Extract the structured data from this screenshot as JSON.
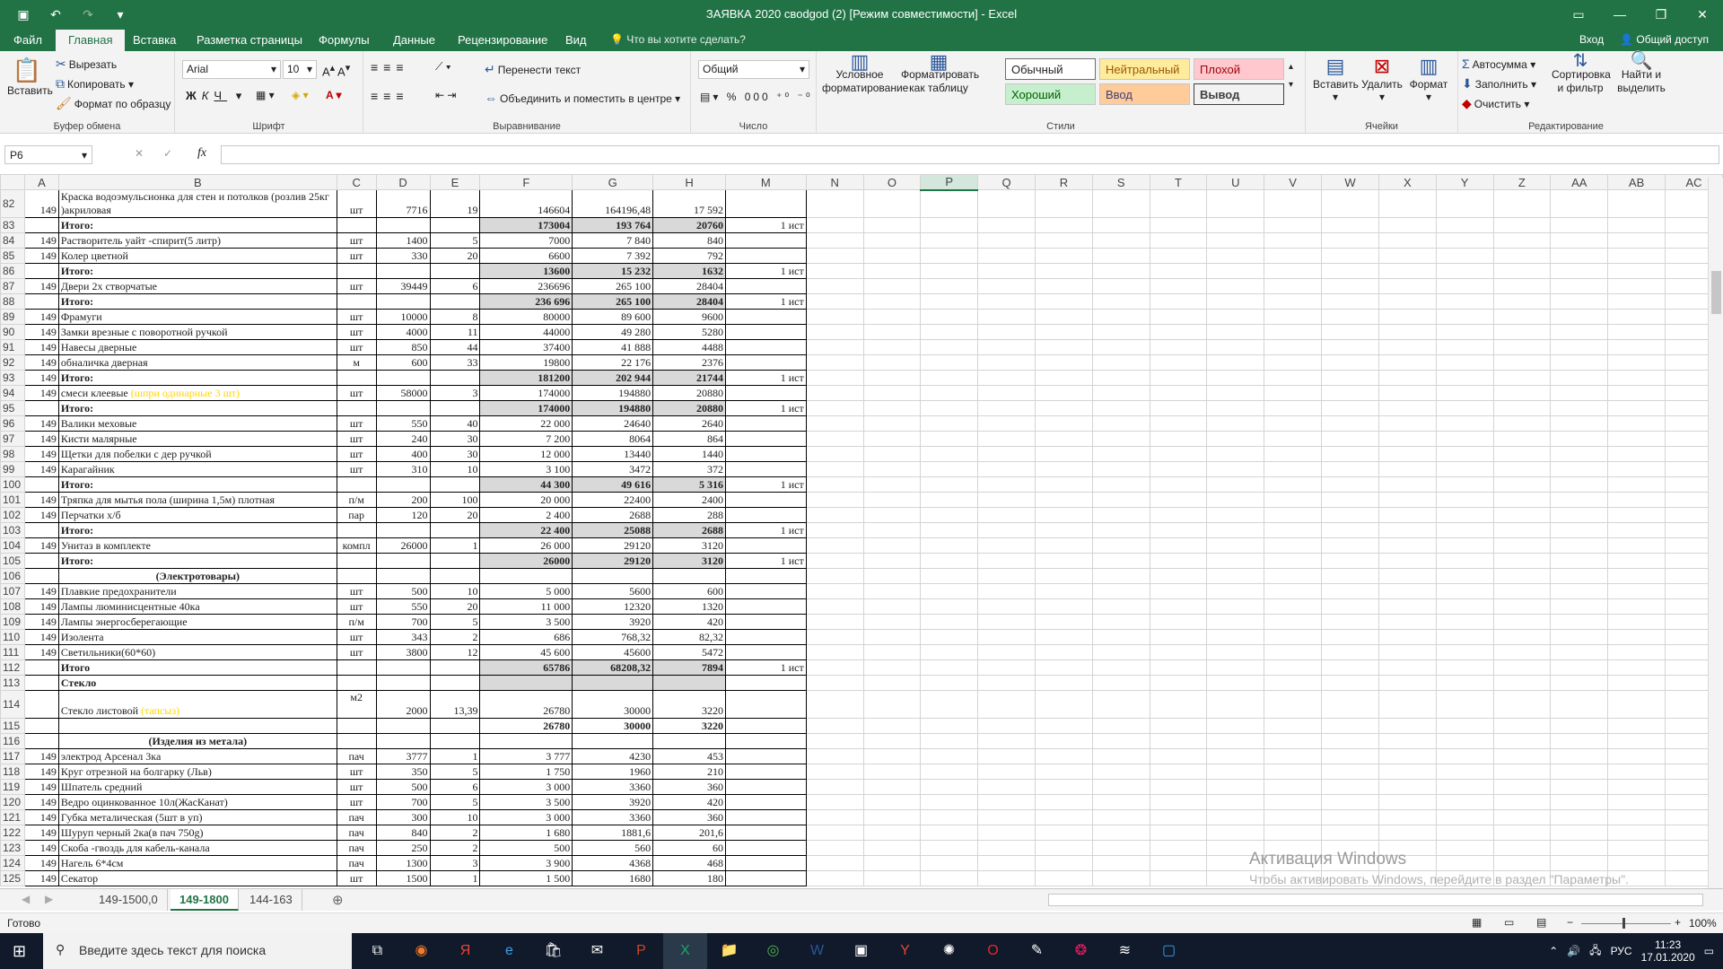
{
  "window": {
    "title": "ЗАЯВКА 2020 свodgod (2)  [Режим совместимости] - Excel",
    "sign_in": "Вход",
    "share": "Общий доступ"
  },
  "menu_tabs": [
    "Файл",
    "Главная",
    "Вставка",
    "Разметка страницы",
    "Формулы",
    "Данные",
    "Рецензирование",
    "Вид"
  ],
  "tell_me": "Что вы хотите сделать?",
  "ribbon": {
    "clipboard": {
      "paste": "Вставить",
      "cut": "Вырезать",
      "copy": "Копировать",
      "format_painter": "Формат по образцу",
      "label": "Буфер обмена"
    },
    "font": {
      "name": "Arial",
      "size": "10",
      "label": "Шрифт"
    },
    "alignment": {
      "wrap": "Перенести текст",
      "merge": "Объединить и поместить в центре",
      "label": "Выравнивание"
    },
    "number": {
      "format": "Общий",
      "label": "Число"
    },
    "styles": {
      "conditional": "Условное форматирование",
      "as_table": "Форматировать как таблицу",
      "normal": "Обычный",
      "neutral": "Нейтральный",
      "bad": "Плохой",
      "good": "Хороший",
      "input": "Ввод",
      "output": "Вывод",
      "label": "Стили"
    },
    "cells": {
      "insert": "Вставить",
      "delete": "Удалить",
      "format": "Формат",
      "label": "Ячейки"
    },
    "editing": {
      "autosum": "Автосумма",
      "fill": "Заполнить",
      "clear": "Очистить",
      "sort": "Сортировка и фильтр",
      "find": "Найти и выделить",
      "label": "Редактирование"
    }
  },
  "namebox": "P6",
  "columns": [
    "A",
    "B",
    "C",
    "D",
    "E",
    "F",
    "G",
    "H",
    "M",
    "N",
    "O",
    "P",
    "Q",
    "R",
    "S",
    "T",
    "U",
    "V",
    "W",
    "X",
    "Y",
    "Z",
    "AA",
    "AB",
    "AC"
  ],
  "rows": [
    {
      "n": "82",
      "a": "149",
      "b": "Краска водоэмульсионка для стен и потолков (розлив 25кг )акриловая",
      "c": "шт",
      "d": "7716",
      "e": "19",
      "f": "146604",
      "g": "164196,48",
      "h": "17 592",
      "m": "",
      "tall": true
    },
    {
      "n": "83",
      "a": "",
      "b": "Итого:",
      "c": "",
      "d": "",
      "e": "",
      "f": "173004",
      "g": "193 764",
      "h": "20760",
      "m": "1 ист",
      "tot": true
    },
    {
      "n": "84",
      "a": "149",
      "b": "Растворитель уайт -спирит(5 литр)",
      "c": "шт",
      "d": "1400",
      "e": "5",
      "f": "7000",
      "g": "7 840",
      "h": "840",
      "m": ""
    },
    {
      "n": "85",
      "a": "149",
      "b": "Колер цветной",
      "c": "шт",
      "d": "330",
      "e": "20",
      "f": "6600",
      "g": "7 392",
      "h": "792",
      "m": ""
    },
    {
      "n": "86",
      "a": "",
      "b": "Итого:",
      "c": "",
      "d": "",
      "e": "",
      "f": "13600",
      "g": "15 232",
      "h": "1632",
      "m": "1 ист",
      "tot": true
    },
    {
      "n": "87",
      "a": "149",
      "b": "Двери 2х створчатые",
      "c": "шт",
      "d": "39449",
      "e": "6",
      "f": "236696",
      "g": "265 100",
      "h": "28404",
      "m": ""
    },
    {
      "n": "88",
      "a": "",
      "b": "Итого:",
      "c": "",
      "d": "",
      "e": "",
      "f": "236 696",
      "g": "265 100",
      "h": "28404",
      "m": "1 ист",
      "tot": true
    },
    {
      "n": "89",
      "a": "149",
      "b": "Фрамуги",
      "c": "шт",
      "d": "10000",
      "e": "8",
      "f": "80000",
      "g": "89 600",
      "h": "9600",
      "m": ""
    },
    {
      "n": "90",
      "a": "149",
      "b": "Замки врезные с поворотной ручкой",
      "c": "шт",
      "d": "4000",
      "e": "11",
      "f": "44000",
      "g": "49 280",
      "h": "5280",
      "m": ""
    },
    {
      "n": "91",
      "a": "149",
      "b": "Навесы дверные",
      "c": "шт",
      "d": "850",
      "e": "44",
      "f": "37400",
      "g": "41 888",
      "h": "4488",
      "m": ""
    },
    {
      "n": "92",
      "a": "149",
      "b": "обналичка дверная",
      "c": "м",
      "d": "600",
      "e": "33",
      "f": "19800",
      "g": "22 176",
      "h": "2376",
      "m": ""
    },
    {
      "n": "93",
      "a": "149",
      "b": "Итого:",
      "c": "",
      "d": "",
      "e": "",
      "f": "181200",
      "g": "202 944",
      "h": "21744",
      "m": "1 ист",
      "tot": true
    },
    {
      "n": "94",
      "a": "149",
      "b": "смеси клеевые ",
      "y": "(шпри одинарные 3 шт)",
      "c": "шт",
      "d": "58000",
      "e": "3",
      "f": "174000",
      "g": "194880",
      "h": "20880",
      "m": ""
    },
    {
      "n": "95",
      "a": "",
      "b": "Итого:",
      "c": "",
      "d": "",
      "e": "",
      "f": "174000",
      "g": "194880",
      "h": "20880",
      "m": "1 ист",
      "tot": true
    },
    {
      "n": "96",
      "a": "149",
      "b": "Валики меховые",
      "c": "шт",
      "d": "550",
      "e": "40",
      "f": "22 000",
      "g": "24640",
      "h": "2640",
      "m": ""
    },
    {
      "n": "97",
      "a": "149",
      "b": "Кисти малярные",
      "c": "шт",
      "d": "240",
      "e": "30",
      "f": "7 200",
      "g": "8064",
      "h": "864",
      "m": ""
    },
    {
      "n": "98",
      "a": "149",
      "b": "Щетки для побелки с дер ручкой",
      "c": "шт",
      "d": "400",
      "e": "30",
      "f": "12 000",
      "g": "13440",
      "h": "1440",
      "m": ""
    },
    {
      "n": "99",
      "a": "149",
      "b": "Карагайник",
      "c": "шт",
      "d": "310",
      "e": "10",
      "f": "3 100",
      "g": "3472",
      "h": "372",
      "m": ""
    },
    {
      "n": "100",
      "a": "",
      "b": "Итого:",
      "c": "",
      "d": "",
      "e": "",
      "f": "44 300",
      "g": "49 616",
      "h": "5 316",
      "m": "1 ист",
      "tot": true
    },
    {
      "n": "101",
      "a": "149",
      "b": "Тряпка для мытья пола (ширина 1,5м) плотная",
      "c": "п/м",
      "d": "200",
      "e": "100",
      "f": "20 000",
      "g": "22400",
      "h": "2400",
      "m": ""
    },
    {
      "n": "102",
      "a": "149",
      "b": "Перчатки х/б",
      "c": "пар",
      "d": "120",
      "e": "20",
      "f": "2 400",
      "g": "2688",
      "h": "288",
      "m": ""
    },
    {
      "n": "103",
      "a": "",
      "b": "Итого:",
      "c": "",
      "d": "",
      "e": "",
      "f": "22 400",
      "g": "25088",
      "h": "2688",
      "m": "1 ист",
      "tot": true
    },
    {
      "n": "104",
      "a": "149",
      "b": "Унитаз в комплекте",
      "c": "компл",
      "d": "26000",
      "e": "1",
      "f": "26 000",
      "g": "29120",
      "h": "3120",
      "m": ""
    },
    {
      "n": "105",
      "a": "",
      "b": "Итого:",
      "c": "",
      "d": "",
      "e": "",
      "f": "26000",
      "g": "29120",
      "h": "3120",
      "m": "1 ист",
      "tot": true
    },
    {
      "n": "106",
      "a": "",
      "b": "(Электротовары)",
      "c": "",
      "d": "",
      "e": "",
      "f": "",
      "g": "",
      "h": "",
      "m": "",
      "sec": true
    },
    {
      "n": "107",
      "a": "149",
      "b": "Плавкие предохранители",
      "c": "шт",
      "d": "500",
      "e": "10",
      "f": "5 000",
      "g": "5600",
      "h": "600",
      "m": ""
    },
    {
      "n": "108",
      "a": "149",
      "b": "Лампы люминисцентные 40ка",
      "c": "шт",
      "d": "550",
      "e": "20",
      "f": "11 000",
      "g": "12320",
      "h": "1320",
      "m": ""
    },
    {
      "n": "109",
      "a": "149",
      "b": "Лампы энергосберегающие",
      "c": "п/м",
      "d": "700",
      "e": "5",
      "f": "3 500",
      "g": "3920",
      "h": "420",
      "m": ""
    },
    {
      "n": "110",
      "a": "149",
      "b": "Изолента",
      "c": "шт",
      "d": "343",
      "e": "2",
      "f": "686",
      "g": "768,32",
      "h": "82,32",
      "m": ""
    },
    {
      "n": "111",
      "a": "149",
      "b": "Светильники(60*60)",
      "c": "шт",
      "d": "3800",
      "e": "12",
      "f": "45 600",
      "g": "45600",
      "h": "5472",
      "m": ""
    },
    {
      "n": "112",
      "a": "",
      "b": "Итого",
      "c": "",
      "d": "",
      "e": "",
      "f": "65786",
      "g": "68208,32",
      "h": "7894",
      "m": "1 ист",
      "tot": true
    },
    {
      "n": "113",
      "a": "",
      "b": "Стекло",
      "c": "",
      "d": "",
      "e": "",
      "f": "",
      "g": "",
      "h": "",
      "m": "",
      "tot": true,
      "bold": true
    },
    {
      "n": "114",
      "a": "",
      "b": "Стекло листовой ",
      "y": "(тапсыз)",
      "c": "м2",
      "d": "2000",
      "e": "13,39",
      "f": "26780",
      "g": "30000",
      "h": "3220",
      "m": "",
      "tall": true
    },
    {
      "n": "115",
      "a": "",
      "b": "",
      "c": "",
      "d": "",
      "e": "",
      "f": "26780",
      "g": "30000",
      "h": "3220",
      "m": "",
      "boldnum": true
    },
    {
      "n": "116",
      "a": "",
      "b": "(Изделия из метала)",
      "c": "",
      "d": "",
      "e": "",
      "f": "",
      "g": "",
      "h": "",
      "m": "",
      "sec": true
    },
    {
      "n": "117",
      "a": "149",
      "b": "электрод Арсенал 3ка",
      "c": "пач",
      "d": "3777",
      "e": "1",
      "f": "3 777",
      "g": "4230",
      "h": "453",
      "m": ""
    },
    {
      "n": "118",
      "a": "149",
      "b": "Круг отрезной на болгарку (Льв)",
      "c": "шт",
      "d": "350",
      "e": "5",
      "f": "1 750",
      "g": "1960",
      "h": "210",
      "m": ""
    },
    {
      "n": "119",
      "a": "149",
      "b": "Шпатель средний",
      "c": "шт",
      "d": "500",
      "e": "6",
      "f": "3 000",
      "g": "3360",
      "h": "360",
      "m": ""
    },
    {
      "n": "120",
      "a": "149",
      "b": "Ведро оцинкованное 10л(ЖасКанат)",
      "c": "шт",
      "d": "700",
      "e": "5",
      "f": "3 500",
      "g": "3920",
      "h": "420",
      "m": ""
    },
    {
      "n": "121",
      "a": "149",
      "b": "Губка металическая (5шт в уп)",
      "c": "пач",
      "d": "300",
      "e": "10",
      "f": "3 000",
      "g": "3360",
      "h": "360",
      "m": ""
    },
    {
      "n": "122",
      "a": "149",
      "b": "Шуруп черный 2ка(в пач 750g)",
      "c": "пач",
      "d": "840",
      "e": "2",
      "f": "1 680",
      "g": "1881,6",
      "h": "201,6",
      "m": ""
    },
    {
      "n": "123",
      "a": "149",
      "b": "Скоба -гвоздь для кабель-канала",
      "c": "пач",
      "d": "250",
      "e": "2",
      "f": "500",
      "g": "560",
      "h": "60",
      "m": ""
    },
    {
      "n": "124",
      "a": "149",
      "b": "Нагель 6*4см",
      "c": "пач",
      "d": "1300",
      "e": "3",
      "f": "3 900",
      "g": "4368",
      "h": "468",
      "m": ""
    },
    {
      "n": "125",
      "a": "149",
      "b": "Секатор",
      "c": "шт",
      "d": "1500",
      "e": "1",
      "f": "1 500",
      "g": "1680",
      "h": "180",
      "m": ""
    }
  ],
  "sheet_tabs": [
    "149-1500,0",
    "149-1800",
    "144-163"
  ],
  "status": {
    "ready": "Готово",
    "zoom": "100%"
  },
  "watermark": {
    "line1": "Активация Windows",
    "line2": "Чтобы активировать Windows, перейдите в раздел \"Параметры\"."
  },
  "taskbar": {
    "search": "Введите здесь текст для поиска",
    "lang": "РУС",
    "time": "11:23",
    "date": "17.01.2020"
  }
}
